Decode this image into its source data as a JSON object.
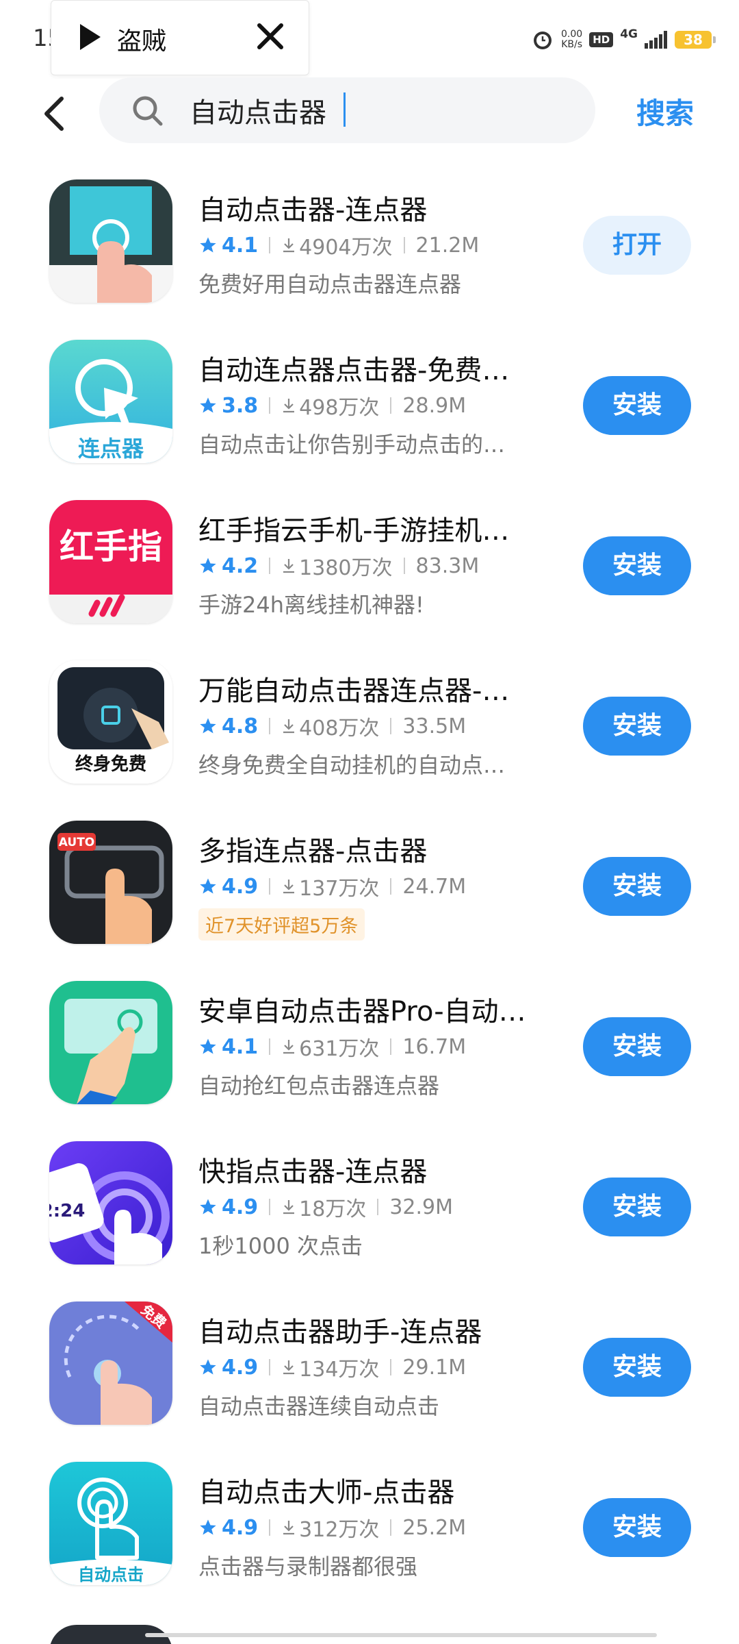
{
  "status_bar": {
    "time": "15:3",
    "netspeed_value": "0.00",
    "netspeed_unit": "KB/s",
    "hd": "HD",
    "network": "4G",
    "battery": "38"
  },
  "media_overlay": {
    "title": "盗贼"
  },
  "search": {
    "query": "自动点击器",
    "submit_label": "搜索"
  },
  "apps": [
    {
      "name": "自动点击器-连点器",
      "rating": "4.1",
      "downloads": "4904万次",
      "size": "21.2M",
      "desc": "免费好用自动点击器连点器",
      "action": "打开"
    },
    {
      "name": "自动连点器点击器-免费…",
      "rating": "3.8",
      "downloads": "498万次",
      "size": "28.9M",
      "desc": "自动点击让你告别手动点击的…",
      "action": "安装",
      "icon_text": "连点器"
    },
    {
      "name": "红手指云手机-手游挂机…",
      "rating": "4.2",
      "downloads": "1380万次",
      "size": "83.3M",
      "desc": "手游24h离线挂机神器!",
      "action": "安装",
      "icon_text": "红手指"
    },
    {
      "name": "万能自动点击器连点器-…",
      "rating": "4.8",
      "downloads": "408万次",
      "size": "33.5M",
      "desc": "终身免费全自动挂机的自动点…",
      "action": "安装",
      "icon_text": "终身免费"
    },
    {
      "name": "多指连点器-点击器",
      "rating": "4.9",
      "downloads": "137万次",
      "size": "24.7M",
      "promo": "近7天好评超5万条",
      "action": "安装",
      "icon_text": "AUTO"
    },
    {
      "name": "安卓自动点击器Pro-自动…",
      "rating": "4.1",
      "downloads": "631万次",
      "size": "16.7M",
      "desc": "自动抢红包点击器连点器",
      "action": "安装"
    },
    {
      "name": "快指点击器-连点器",
      "rating": "4.9",
      "downloads": "18万次",
      "size": "32.9M",
      "desc": "1秒1000 次点击",
      "action": "安装",
      "icon_text": "2:24"
    },
    {
      "name": "自动点击器助手-连点器",
      "rating": "4.9",
      "downloads": "134万次",
      "size": "29.1M",
      "desc": "自动点击器连续自动点击",
      "action": "安装",
      "icon_text": "免费"
    },
    {
      "name": "自动点击大师-点击器",
      "rating": "4.9",
      "downloads": "312万次",
      "size": "25.2M",
      "desc": "点击器与录制器都很强",
      "action": "安装",
      "icon_text": "自动点击"
    }
  ],
  "colors": {
    "accent": "#2b8ff0",
    "open_button_bg": "#e7f2fd",
    "promo_text": "#e0922a"
  }
}
